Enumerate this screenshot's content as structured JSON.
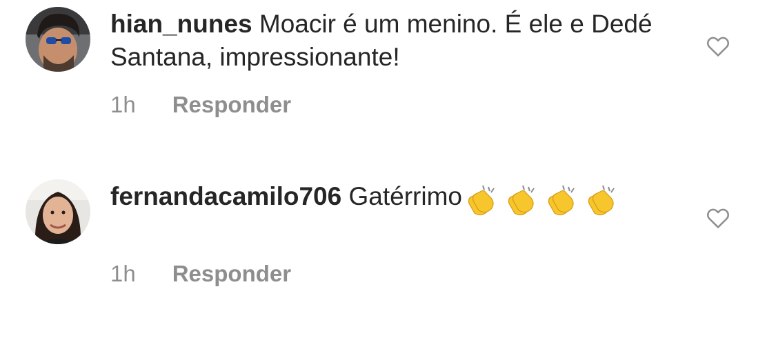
{
  "comments": [
    {
      "username": "hian_nunes",
      "text": " Moacir é um menino. É ele e Dedé Santana, impressionante!",
      "emoji_count": 0,
      "time": "1h",
      "reply_label": "Responder",
      "icons": {
        "avatar": "user-avatar-sunglasses",
        "like": "heart-outline-icon"
      }
    },
    {
      "username": "fernandacamilo706",
      "text": " Gatérrimo",
      "emoji_count": 4,
      "emoji_name": "clapping-hands",
      "time": "1h",
      "reply_label": "Responder",
      "icons": {
        "avatar": "user-avatar-woman",
        "like": "heart-outline-icon"
      }
    }
  ],
  "colors": {
    "text": "#262626",
    "secondary": "#8e8e8e",
    "background": "#ffffff"
  }
}
